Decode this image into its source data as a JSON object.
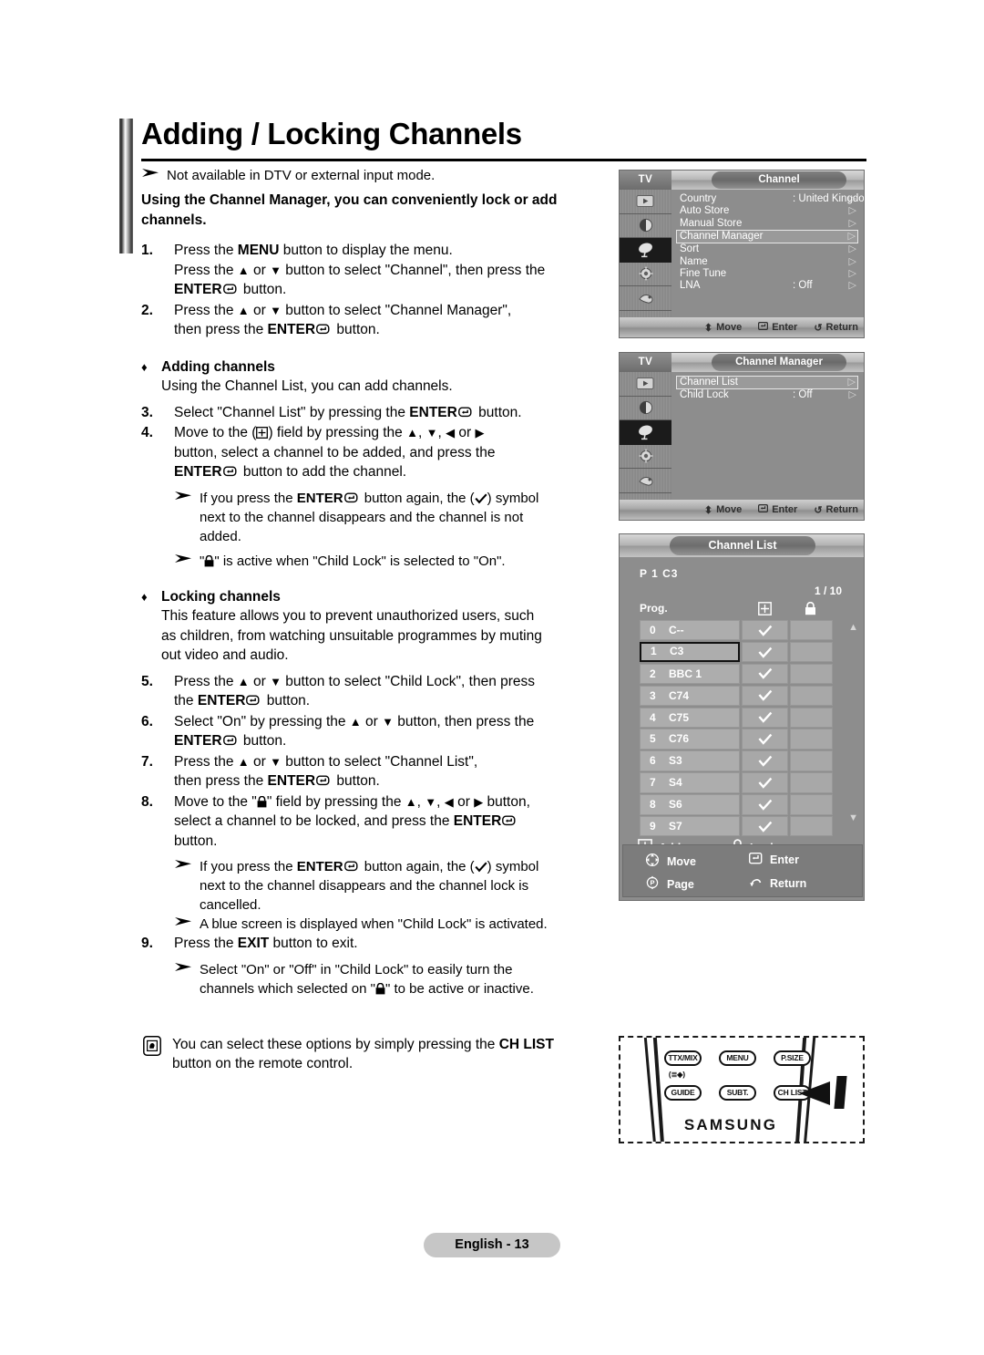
{
  "page": {
    "title": "Adding / Locking Channels",
    "footer_label": "English - 13"
  },
  "intro": {
    "note1": "Not available in DTV or external input mode.",
    "lead": "Using the Channel Manager, you can conveniently lock or add channels."
  },
  "steps": {
    "s1_num": "1.",
    "s1_a_pre": "Press the ",
    "s1_a_menu": "MENU",
    "s1_a_post": " button to display the menu.",
    "s1_b_pre": "Press the ",
    "s1_b_mid": " or ",
    "s1_b_post": " button to select \"Channel\", then press the",
    "s1_c_enter": "ENTER",
    "s1_c_post": " button.",
    "s2_num": "2.",
    "s2_a_pre": "Press the ",
    "s2_a_mid": " or ",
    "s2_a_post": " button to select \"Channel Manager\",",
    "s2_b_pre": "then press the ",
    "s2_b_enter": "ENTER",
    "s2_b_post": " button.",
    "adding_head": "Adding channels",
    "adding_desc": "Using the Channel List, you can add channels.",
    "s3_num": "3.",
    "s3_pre": "Select \"Channel List\" by pressing the ",
    "s3_enter": "ENTER",
    "s3_post": " button.",
    "s4_num": "4.",
    "s4_a_pre": "Move to the (",
    "s4_a_mid": ") field by pressing the ",
    "s4_a_post": " or ",
    "s4_b": "button, select a channel to be added, and press the",
    "s4_c_enter": "ENTER",
    "s4_c_post": " button to add the channel.",
    "n4a_pre": "If you press the ",
    "n4a_enter": "ENTER",
    "n4a_mid": " button again, the (",
    "n4a_post": ") symbol",
    "n4a_l2": "next to the channel disappears and the channel is not",
    "n4a_l3": "added.",
    "n4b_pre": "\"",
    "n4b_post": "\" is active when \"Child Lock\" is selected to \"On\".",
    "locking_head": "Locking channels",
    "locking_d1": "This feature allows you to prevent unauthorized users, such",
    "locking_d2": "as children, from watching unsuitable programmes by muting",
    "locking_d3": "out video and audio.",
    "s5_num": "5.",
    "s5_a_pre": "Press the ",
    "s5_a_mid": " or ",
    "s5_a_post": " button to select \"Child Lock\", then press",
    "s5_b_pre": "the ",
    "s5_b_enter": "ENTER",
    "s5_b_post": " button.",
    "s6_num": "6.",
    "s6_a_pre": "Select \"On\" by pressing the ",
    "s6_a_mid": " or ",
    "s6_a_post": " button, then press the",
    "s6_b_enter": "ENTER",
    "s6_b_post": " button.",
    "s7_num": "7.",
    "s7_a_pre": "Press the ",
    "s7_a_mid": " or ",
    "s7_a_post": " button to select \"Channel List\",",
    "s7_b_pre": "then press the ",
    "s7_b_enter": "ENTER",
    "s7_b_post": " button.",
    "s8_num": "8.",
    "s8_a_pre": "Move to the \"",
    "s8_a_mid": "\" field by pressing the ",
    "s8_a_post": " or ",
    "s8_a_end": " button,",
    "s8_b_pre": "select a channel to be locked, and press the ",
    "s8_b_enter": "ENTER",
    "s8_c": "button.",
    "n8a_pre": "If you press the ",
    "n8a_enter": "ENTER",
    "n8a_mid": " button again, the (",
    "n8a_post": ") symbol",
    "n8a_l2": "next to the channel disappears and the channel lock is",
    "n8a_l3": "cancelled.",
    "n8b": "A blue screen is displayed when \"Child Lock\" is activated.",
    "s9_num": "9.",
    "s9_pre": "Press the ",
    "s9_exit": "EXIT",
    "s9_post": " button to exit.",
    "n9_l1": "Select \"On\" or \"Off\" in \"Child Lock\" to easily turn the",
    "n9_l2_pre": "channels which selected on \"",
    "n9_l2_post": "\" to be active or inactive.",
    "tip_l1_pre": "You can select these options by simply pressing the ",
    "tip_l1_bold": "CH LIST",
    "tip_l2": "button on the remote control."
  },
  "osd_channel": {
    "tv_label": "TV",
    "title": "Channel",
    "items": [
      {
        "label": "Country",
        "value": ": United Kingdom",
        "selected": false
      },
      {
        "label": "Auto Store",
        "value": "",
        "selected": false
      },
      {
        "label": "Manual Store",
        "value": "",
        "selected": false
      },
      {
        "label": "Channel Manager",
        "value": "",
        "selected": true
      },
      {
        "label": "Sort",
        "value": "",
        "selected": false
      },
      {
        "label": "Name",
        "value": "",
        "selected": false
      },
      {
        "label": "Fine Tune",
        "value": "",
        "selected": false
      },
      {
        "label": "LNA",
        "value": ": Off",
        "selected": false
      }
    ],
    "bottom": {
      "move": "Move",
      "enter": "Enter",
      "return": "Return"
    }
  },
  "osd_manager": {
    "tv_label": "TV",
    "title": "Channel Manager",
    "items": [
      {
        "label": "Channel List",
        "value": "",
        "selected": true
      },
      {
        "label": "Child Lock",
        "value": ": Off",
        "selected": false
      }
    ],
    "bottom": {
      "move": "Move",
      "enter": "Enter",
      "return": "Return"
    }
  },
  "channel_list": {
    "title": "Channel List",
    "current": "P  1  C3",
    "page_indicator": "1 / 10",
    "col_prog": "Prog.",
    "rows": [
      {
        "num": "0",
        "name": "C--",
        "added": true,
        "locked": false,
        "selected": false
      },
      {
        "num": "1",
        "name": "C3",
        "added": true,
        "locked": false,
        "selected": true
      },
      {
        "num": "2",
        "name": "BBC 1",
        "added": true,
        "locked": false,
        "selected": false
      },
      {
        "num": "3",
        "name": "C74",
        "added": true,
        "locked": false,
        "selected": false
      },
      {
        "num": "4",
        "name": "C75",
        "added": true,
        "locked": false,
        "selected": false
      },
      {
        "num": "5",
        "name": "C76",
        "added": true,
        "locked": false,
        "selected": false
      },
      {
        "num": "6",
        "name": "S3",
        "added": true,
        "locked": false,
        "selected": false
      },
      {
        "num": "7",
        "name": "S4",
        "added": true,
        "locked": false,
        "selected": false
      },
      {
        "num": "8",
        "name": "S6",
        "added": true,
        "locked": false,
        "selected": false
      },
      {
        "num": "9",
        "name": "S7",
        "added": true,
        "locked": false,
        "selected": false
      }
    ],
    "legend_add": "Add",
    "legend_lock": "Lock",
    "foot": {
      "move": "Move",
      "page": "Page",
      "enter": "Enter",
      "return": "Return"
    }
  },
  "remote": {
    "brand": "SAMSUNG",
    "buttons": {
      "ttxmix": "TTX/MIX",
      "menu": "MENU",
      "psize": "P.SIZE",
      "guide": "GUIDE",
      "subt": "SUBT.",
      "chlist": "CH LIST"
    }
  }
}
